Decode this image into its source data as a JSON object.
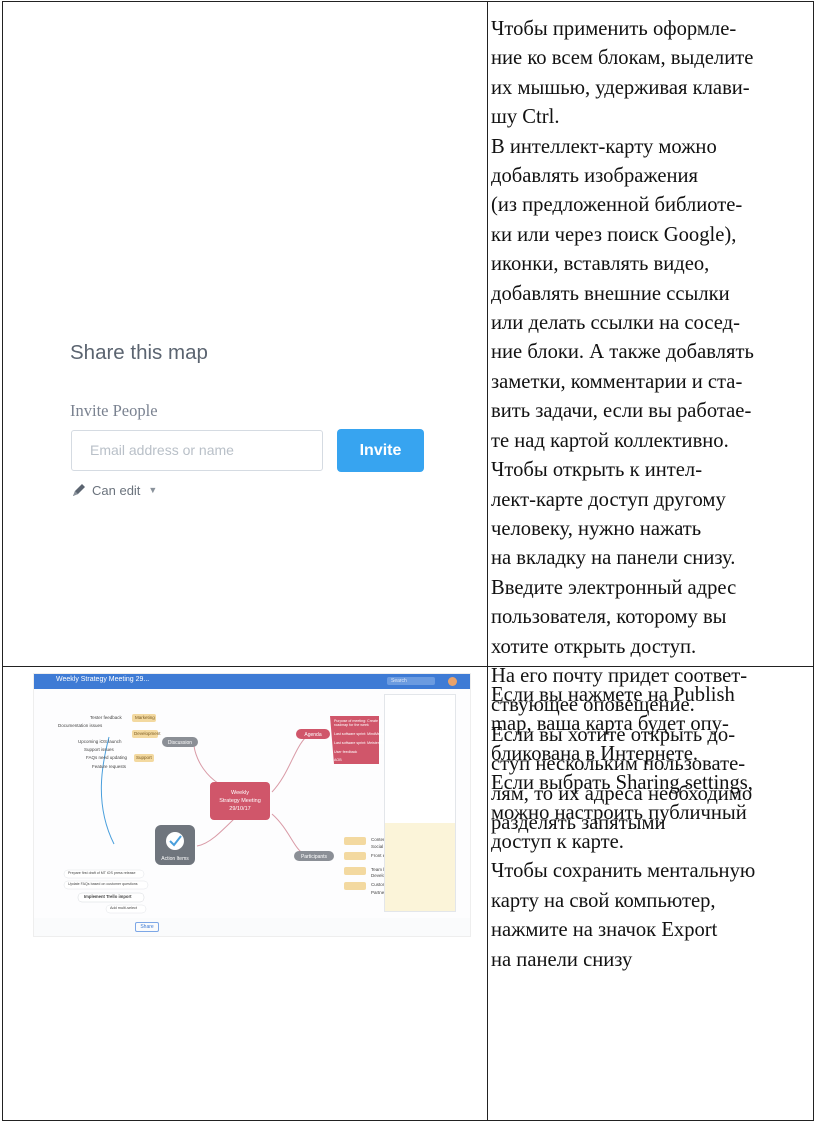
{
  "share_dialog": {
    "title": "Share this map",
    "invite_label": "Invite People",
    "email_placeholder": "Email address or name",
    "invite_button": "Invite",
    "permission": "Can edit",
    "icons": {
      "permission": "pencil-icon",
      "dropdown": "caret-down-icon"
    }
  },
  "text_block_1": {
    "lines": [
      "Чтобы применить оформле-",
      "ние ко всем блокам, выделите",
      "их мышью, удерживая клави-",
      "шу Ctrl.",
      "В интеллект-карту можно",
      "добавлять изображения",
      "(из предложенной библиоте-",
      "ки или через поиск Google),",
      "иконки, вставлять видео,",
      "добавлять внешние ссылки",
      "или делать ссылки на сосед-",
      "ние блоки. А также добавлять",
      "заметки, комментарии и ста-",
      "вить задачи, если вы работае-",
      "те над картой коллективно.",
      "Чтобы открыть к интел-",
      "лект-карте доступ другому",
      "человеку, нужно нажать",
      "на вкладку на панели снизу.",
      "Введите электронный адрес",
      "пользователя, которому вы",
      "хотите открыть доступ.",
      "На его почту придет соответ-",
      "ствующее оповещение.",
      "Если вы хотите открыть до-",
      "ступ нескольким пользовате-",
      "лям, то их адреса необходимо",
      "разделять запятыми"
    ]
  },
  "text_block_2": {
    "lines": [
      "Если вы нажмете на Publish",
      "map, ваша карта будет опу-",
      "бликована в Интернете.",
      "Если выбрать Sharing settings,",
      "можно настроить публичный",
      "доступ к карте.",
      "Чтобы сохранить ментальную",
      "карту на свой компьютер,",
      "нажмите на значок Export",
      "на панели снизу"
    ]
  },
  "mindmap_screenshot": {
    "window_title": "Weekly Strategy Meeting 29...",
    "search_placeholder": "Search",
    "central_node": [
      "Weekly",
      "Strategy Meeting",
      "29/10/17"
    ],
    "branches": {
      "discussion": "Discussion",
      "agenda": "Agenda",
      "participants": "Participants",
      "action_items": "Action Items"
    },
    "discussion_items": [
      "Tester feedback",
      "Marketing",
      "Documentation issues",
      "Development",
      "Upcoming iOS launch",
      "Support issues",
      "FAQs need updating",
      "Support",
      "Feature requests"
    ],
    "agenda_items": [
      "Purpose of meeting: Create roadmap for the week",
      "Last software sprint: MindMeister",
      "Last software sprint: Meister Task",
      "User feedback",
      "AOB"
    ],
    "participant_items": [
      "Content",
      "Social media",
      "Front end",
      "Team leader",
      "Development",
      "Customer Support",
      "Partner Management"
    ],
    "action_item_entries": [
      "Prepare first draft of MT iOS press release",
      "Update FAQs based on customer questions",
      "Implement Trello import",
      "Add multi-select"
    ],
    "share_button": "Share",
    "colors": {
      "topbar": "#3e7bd5",
      "central": "#d0566a",
      "agenda": "#d0566a",
      "branch": "#8b8f96",
      "action": "#6f757d"
    }
  },
  "colors": {
    "invite_button": "#37a4f0",
    "border": "#222222",
    "text": "#111111"
  }
}
